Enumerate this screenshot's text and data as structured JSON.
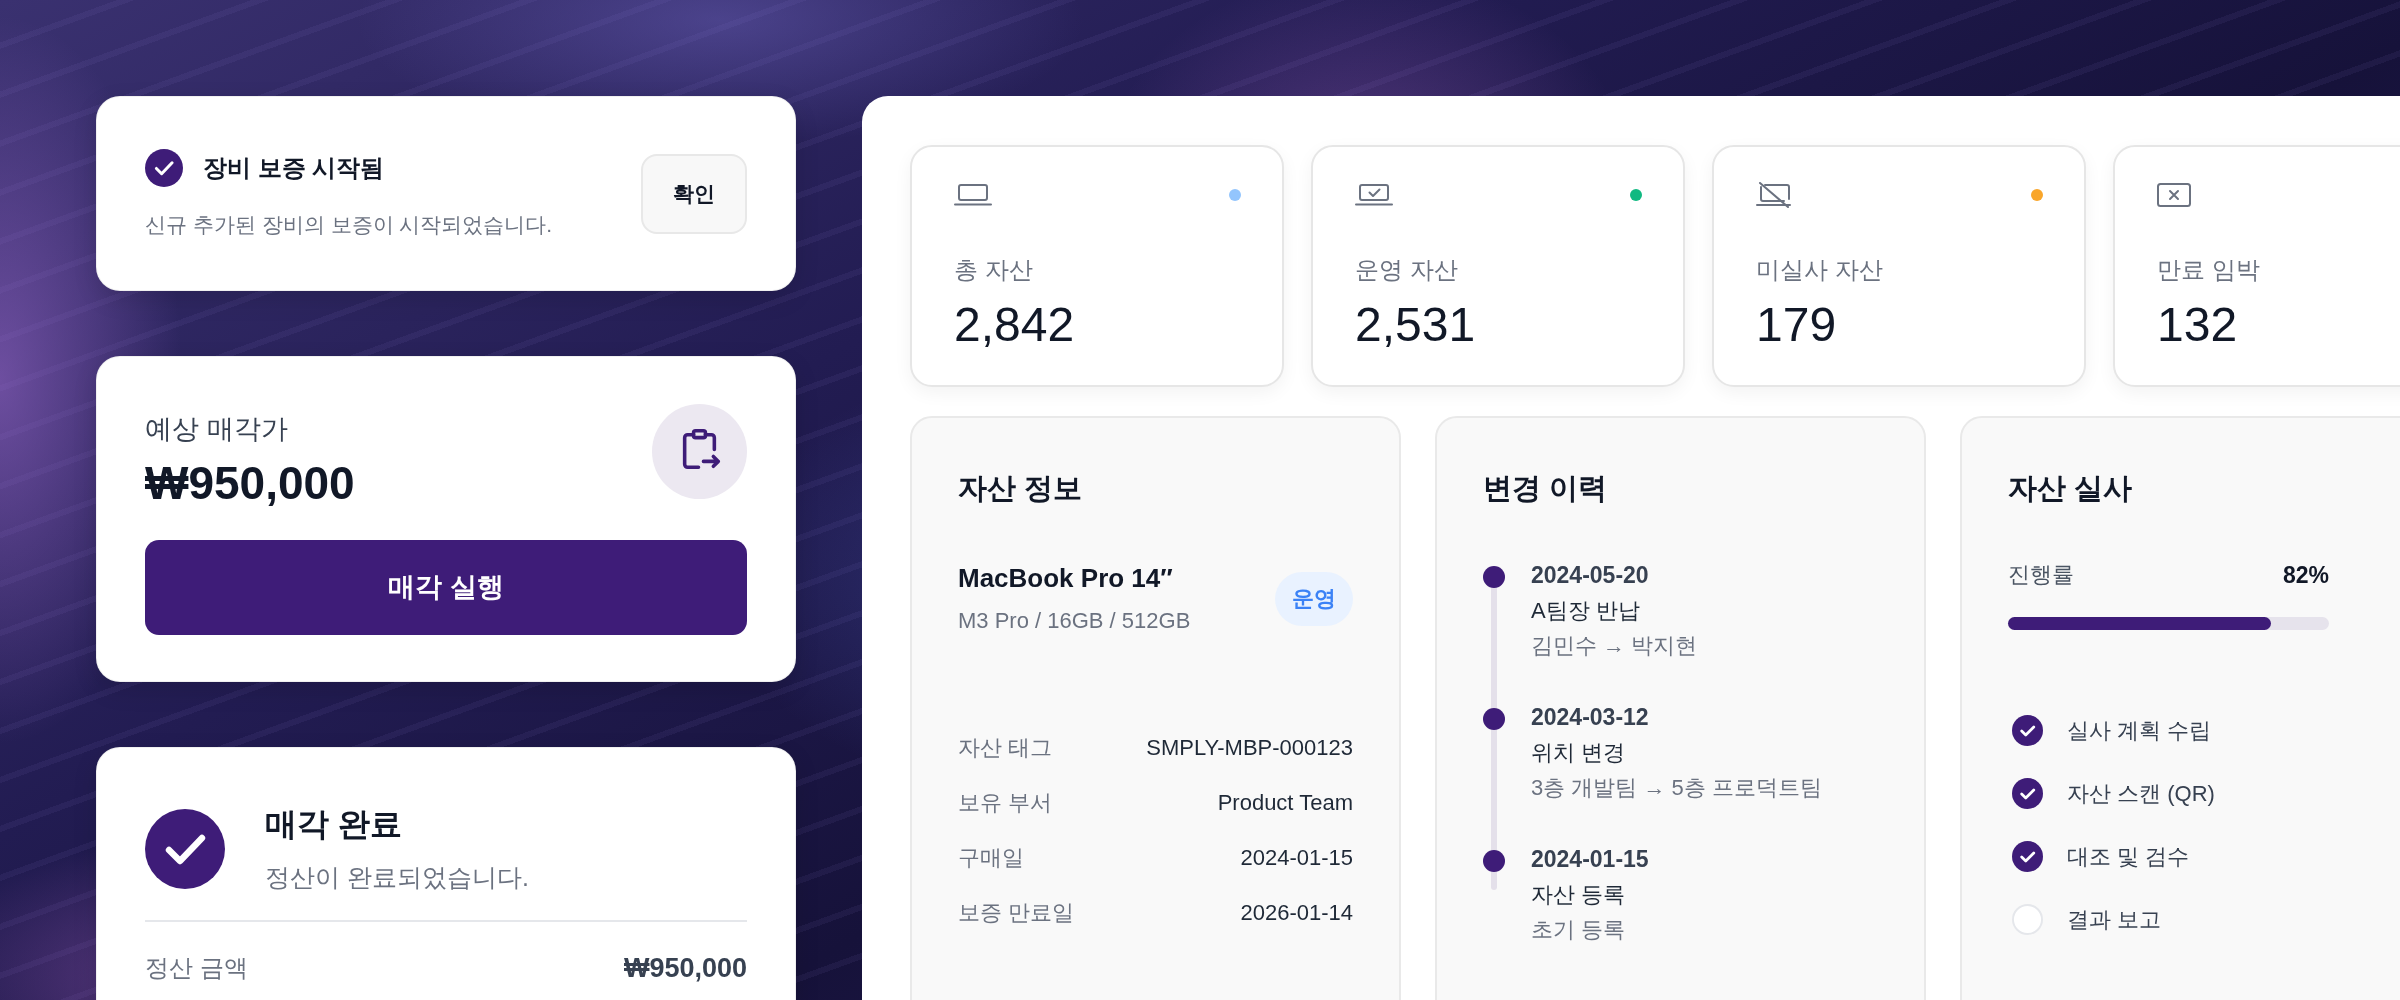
{
  "notification": {
    "title": "장비 보증 시작됨",
    "message": "신규 추가된 장비의 보증이 시작되었습니다.",
    "button": "확인"
  },
  "sale_estimate": {
    "label": "예상 매각가",
    "amount": "₩950,000",
    "button": "매각 실행"
  },
  "sale_complete": {
    "title": "매각 완료",
    "message": "정산이 완료되었습니다.",
    "summary": {
      "label": "정산 금액",
      "value": "₩950,000"
    }
  },
  "stats": [
    {
      "kind": "total",
      "label": "총 자산",
      "value": "2,842",
      "color": "#93c5fd"
    },
    {
      "kind": "active",
      "label": "운영 자산",
      "value": "2,531",
      "color": "#10b981"
    },
    {
      "kind": "unaudited",
      "label": "미실사 자산",
      "value": "179",
      "color": "#f9a62b"
    },
    {
      "kind": "expiring",
      "label": "만료 임박",
      "value": "132"
    }
  ],
  "asset_info": {
    "title": "자산 정보",
    "name": "MacBook Pro 14″",
    "spec": "M3 Pro / 16GB / 512GB",
    "status": "운영",
    "fields": [
      {
        "label": "자산 태그",
        "value": "SMPLY-MBP-000123"
      },
      {
        "label": "보유 부서",
        "value": "Product Team"
      },
      {
        "label": "구매일",
        "value": "2024-01-15"
      },
      {
        "label": "보증 만료일",
        "value": "2026-01-14"
      }
    ]
  },
  "history": {
    "title": "변경 이력",
    "items": [
      {
        "date": "2024-05-20",
        "title": "A팀장 반납",
        "detail": "김민수 → 박지현"
      },
      {
        "date": "2024-03-12",
        "title": "위치 변경",
        "detail": "3층 개발팀 → 5층 프로덕트팀"
      },
      {
        "date": "2024-01-15",
        "title": "자산 등록",
        "detail": "초기 등록"
      }
    ]
  },
  "audit": {
    "title": "자산 실사",
    "progress": {
      "label": "진행률",
      "reading": "82%",
      "level": 0.82
    },
    "steps": [
      {
        "label": "실사 계획 수립",
        "checked": true
      },
      {
        "label": "자산 스캔 (QR)",
        "checked": true
      },
      {
        "label": "대조 및 검수",
        "checked": true
      },
      {
        "label": "결과 보고",
        "checked": false
      }
    ]
  }
}
